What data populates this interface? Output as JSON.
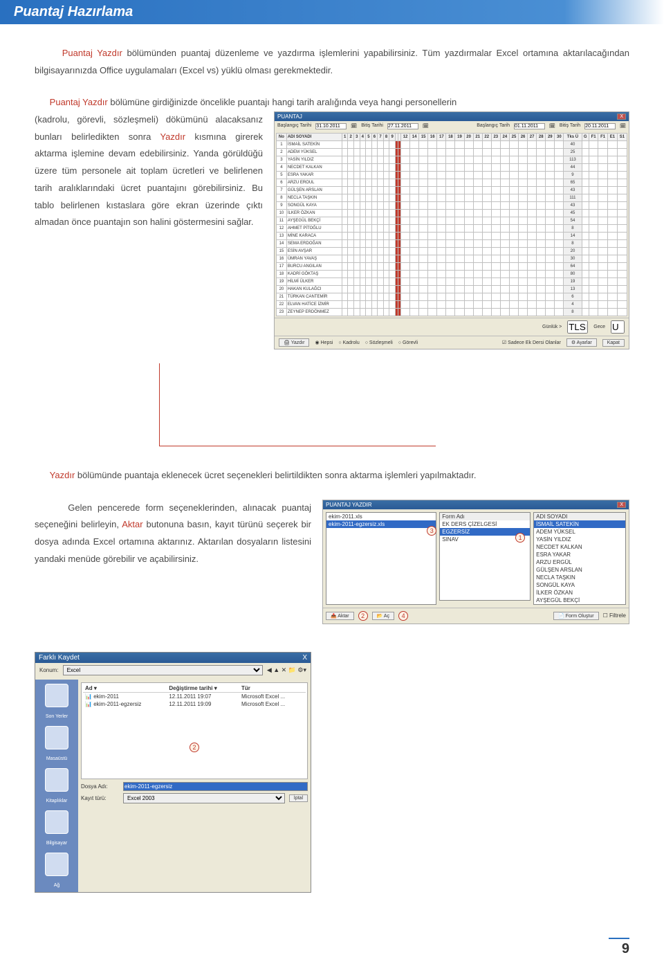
{
  "header": {
    "title": "Puantaj Hazırlama"
  },
  "para1": {
    "highlight": "Puantaj Yazdır",
    "rest": " bölümünden puantaj düzenleme ve yazdırma işlemlerini yapabilirsiniz. Tüm yazdırmalar Excel ortamına aktarılacağından bilgisayarınızda Office uygulamaları (Excel vs) yüklü olması gerekmektedir."
  },
  "para2": {
    "part1": "Puantaj Yazdır",
    "part2": " bölümüne girdiğinizde öncelikle puantajı hangi tarih aralığında veya hangi personellerin (kadrolu, görevli, sözleşmeli) dökümünü alacaksanız bunları belirledikten sonra ",
    "part3": "Yazdır",
    "part4": " kısmına girerek aktarma işlemine devam edebilirsiniz. Yanda görüldüğü üzere tüm personele ait toplam ücretleri ve belirlenen tarih aralıklarındaki ücret puantajını görebilirsiniz. Bu tablo belirlenen kıstaslara göre ekran üzerinde çıktı almadan önce puantajın son halini göstermesini sağlar."
  },
  "shot1": {
    "title": "PUANTAJ",
    "close": "X",
    "labels": {
      "l1": "Başlangıç Tarihi",
      "l2": "Bitiş Tarihi",
      "l3": "Başlangıç Tarih",
      "l4": "Bitiş Tarih"
    },
    "dates": {
      "d1": "31.10.2011",
      "d2": "27.11.2011",
      "d3": "01.11.2011",
      "d4": "20.11.2011"
    },
    "headers": {
      "no": "No",
      "adi": "ADI SOYADI",
      "tks": "Tks Ü"
    },
    "days_a": [
      "1",
      "2",
      "3",
      "4",
      "5",
      "6",
      "7",
      "8",
      "9"
    ],
    "days_b": [
      "12",
      "14",
      "15",
      "16",
      "17",
      "18",
      "19",
      "20",
      "21",
      "22",
      "23",
      "24",
      "25",
      "26",
      "27",
      "28",
      "29",
      "30"
    ],
    "cols_end": [
      "G",
      "F1",
      "F1",
      "E1",
      "S1"
    ],
    "rows": [
      {
        "no": "1",
        "name": "İSMAİL SATEKİN",
        "tot": "40"
      },
      {
        "no": "2",
        "name": "ADEM YÜKSEL",
        "tot": "25"
      },
      {
        "no": "3",
        "name": "YASİN YILDIZ",
        "tot": "113"
      },
      {
        "no": "4",
        "name": "NECDET KALKAN",
        "tot": "44"
      },
      {
        "no": "5",
        "name": "ESRA YAKAR",
        "tot": "9"
      },
      {
        "no": "6",
        "name": "ARZU EROUL",
        "tot": "65"
      },
      {
        "no": "7",
        "name": "GÜLŞEN ARSLAN",
        "tot": "43"
      },
      {
        "no": "8",
        "name": "NECLA TAŞKIN",
        "tot": "111"
      },
      {
        "no": "9",
        "name": "SONGÜL KAYA",
        "tot": "43"
      },
      {
        "no": "10",
        "name": "İLKER ÖZKAN",
        "tot": "45"
      },
      {
        "no": "11",
        "name": "AYŞEGÜL BEKÇİ",
        "tot": "54"
      },
      {
        "no": "12",
        "name": "AHMET PİTOĞLU",
        "tot": "8"
      },
      {
        "no": "13",
        "name": "MİNE KARACA",
        "tot": "14"
      },
      {
        "no": "14",
        "name": "SEMA ERDOĞAN",
        "tot": "8"
      },
      {
        "no": "15",
        "name": "ESİN AVŞAR",
        "tot": "20"
      },
      {
        "no": "16",
        "name": "ÜMRAN YAVAŞ",
        "tot": "30"
      },
      {
        "no": "17",
        "name": "BURCU ANGILAN",
        "tot": "64"
      },
      {
        "no": "18",
        "name": "KADRİ GÖKTAŞ",
        "tot": "80"
      },
      {
        "no": "19",
        "name": "HİLMİ ÜLKER",
        "tot": "19"
      },
      {
        "no": "20",
        "name": "HAKAN KULAĞCI",
        "tot": "13"
      },
      {
        "no": "21",
        "name": "TÜRKAN CANTEMİR",
        "tot": "6"
      },
      {
        "no": "22",
        "name": "ELVAN HATİCE İZMİR",
        "tot": "4"
      },
      {
        "no": "23",
        "name": "ZEYNEP ERDÖNMEZ",
        "tot": "8"
      }
    ],
    "footer": {
      "yazdir": "Yazdır",
      "hepsi": "Hepsi",
      "kadrolu": "Kadrolu",
      "sozlesmeli": "Sözleşmeli",
      "gorevli": "Görevli",
      "sadece": "Sadece Ek Dersi Olanlar",
      "gunluk": "Günlük >",
      "tlsh": "TLSH/",
      "geca": "Gece",
      "gece_v": "U",
      "ayarlar": "Ayarlar",
      "kapat": "Kapat"
    }
  },
  "para3": {
    "highlight": "Yazdır",
    "rest": " bölümünde puantaja eklenecek ücret seçenekleri belirtildikten sonra aktarma işlemleri yapılmaktadır."
  },
  "para4": {
    "p1": "Gelen pencerede form seçeneklerinden, alınacak puantaj seçeneğini belirleyin, ",
    "aktar": "Aktar",
    "p2": " butonuna basın, kayıt türünü seçerek bir dosya adında Excel ortamına aktarınız. Aktarılan dosyaların listesini yandaki menüde görebilir ve açabilirsiniz."
  },
  "shot2": {
    "title": "PUANTAJ YAZDIR",
    "files": [
      "ekim-2011.xls",
      "ekim-2011-egzersiz.xls"
    ],
    "forms_lbl": "Form Adı",
    "forms": [
      "EK DERS ÇİZELGESİ",
      "EGZERSİZ",
      "SINAV"
    ],
    "names_lbl": "ADI SOYADI",
    "names": [
      "İSMAİL SATEKİN",
      "ADEM YÜKSEL",
      "YASİN YILDIZ",
      "NECDET KALKAN",
      "ESRA YAKAR",
      "ARZU ERGÜL",
      "GÜLŞEN ARSLAN",
      "NECLA TAŞKIN",
      "SONGÜL KAYA",
      "İLKER ÖZKAN",
      "AYŞEGÜL BEKÇİ"
    ],
    "btns": {
      "aktar": "Aktar",
      "ac": "Aç",
      "form": "Form Oluştur",
      "filtre": "Filtrele"
    },
    "circles": {
      "c1": "1",
      "c2": "2",
      "c3": "3",
      "c4": "4"
    }
  },
  "savedlg": {
    "title": "Farklı Kaydet",
    "konum": "Konum:",
    "konum_v": "Excel",
    "side": [
      "Son Yerler",
      "Masaüstü",
      "Kitaplıklar",
      "Bilgisayar",
      "Ağ"
    ],
    "cols": {
      "ad": "Ad",
      "tarih": "Değiştirme tarihi",
      "tur": "Tür"
    },
    "files": [
      {
        "ad": "ekim-2011",
        "tarih": "12.11.2011 19:07",
        "tur": "Microsoft Excel ..."
      },
      {
        "ad": "ekim-2011-egzersiz",
        "tarih": "12.11.2011 19:09",
        "tur": "Microsoft Excel ..."
      }
    ],
    "dosya_lbl": "Dosya Adı:",
    "dosya_v": "ekim-2011-egzersiz",
    "kayit_lbl": "Kayıt türü:",
    "kayit_v": "Excel 2003",
    "iptal": "İptal",
    "circle2": "2"
  },
  "page_num": "9"
}
